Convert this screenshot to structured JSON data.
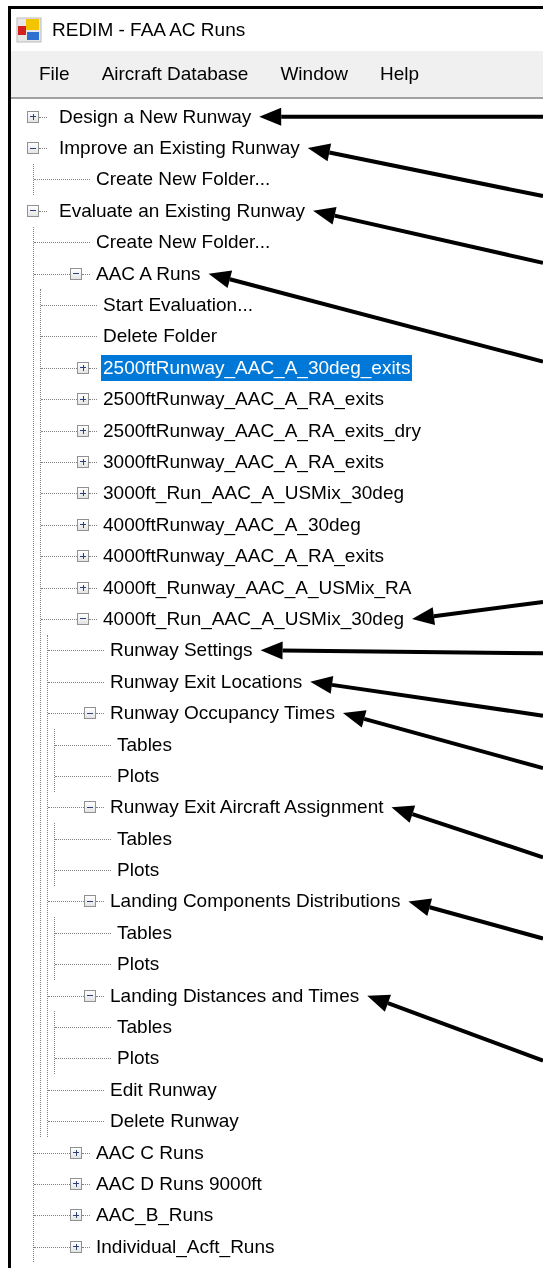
{
  "window": {
    "title": "REDIM - FAA AC Runs"
  },
  "menu": [
    {
      "label": "File"
    },
    {
      "label": "Aircraft Database"
    },
    {
      "label": "Window"
    },
    {
      "label": "Help"
    }
  ],
  "tree": [
    {
      "label": "Design a New Runway",
      "expanded": false,
      "selected": false,
      "arrow": true
    },
    {
      "label": "Improve an Existing Runway",
      "expanded": true,
      "selected": false,
      "arrow": true,
      "children": [
        {
          "label": "Create New Folder...",
          "selected": false,
          "arrow": false
        }
      ]
    },
    {
      "label": "Evaluate an Existing Runway",
      "expanded": true,
      "selected": false,
      "arrow": true,
      "children": [
        {
          "label": "Create New Folder...",
          "selected": false,
          "arrow": false
        },
        {
          "label": "AAC A Runs",
          "expanded": true,
          "selected": false,
          "arrow": true,
          "children": [
            {
              "label": "Start Evaluation...",
              "selected": false,
              "arrow": false
            },
            {
              "label": "Delete Folder",
              "selected": false,
              "arrow": false
            },
            {
              "label": "2500ftRunway_AAC_A_30deg_exits",
              "expanded": false,
              "selected": true,
              "arrow": false
            },
            {
              "label": "2500ftRunway_AAC_A_RA_exits",
              "expanded": false,
              "selected": false,
              "arrow": false
            },
            {
              "label": "2500ftRunway_AAC_A_RA_exits_dry",
              "expanded": false,
              "selected": false,
              "arrow": false
            },
            {
              "label": "3000ftRunway_AAC_A_RA_exits",
              "expanded": false,
              "selected": false,
              "arrow": false
            },
            {
              "label": "3000ft_Run_AAC_A_USMix_30deg",
              "expanded": false,
              "selected": false,
              "arrow": false
            },
            {
              "label": "4000ftRunway_AAC_A_30deg",
              "expanded": false,
              "selected": false,
              "arrow": false
            },
            {
              "label": "4000ftRunway_AAC_A_RA_exits",
              "expanded": false,
              "selected": false,
              "arrow": false
            },
            {
              "label": "4000ft_Runway_AAC_A_USMix_RA",
              "expanded": false,
              "selected": false,
              "arrow": false
            },
            {
              "label": "4000ft_Run_AAC_A_USMix_30deg",
              "expanded": true,
              "selected": false,
              "arrow": true,
              "children": [
                {
                  "label": "Runway Settings",
                  "selected": false,
                  "arrow": true
                },
                {
                  "label": "Runway Exit Locations",
                  "selected": false,
                  "arrow": true
                },
                {
                  "label": "Runway Occupancy Times",
                  "expanded": true,
                  "selected": false,
                  "arrow": true,
                  "children": [
                    {
                      "label": "Tables",
                      "selected": false,
                      "arrow": false
                    },
                    {
                      "label": "Plots",
                      "selected": false,
                      "arrow": false
                    }
                  ]
                },
                {
                  "label": "Runway Exit Aircraft Assignment",
                  "expanded": true,
                  "selected": false,
                  "arrow": true,
                  "children": [
                    {
                      "label": "Tables",
                      "selected": false,
                      "arrow": false
                    },
                    {
                      "label": "Plots",
                      "selected": false,
                      "arrow": false
                    }
                  ]
                },
                {
                  "label": "Landing Components Distributions",
                  "expanded": true,
                  "selected": false,
                  "arrow": true,
                  "children": [
                    {
                      "label": "Tables",
                      "selected": false,
                      "arrow": false
                    },
                    {
                      "label": "Plots",
                      "selected": false,
                      "arrow": false
                    }
                  ]
                },
                {
                  "label": "Landing Distances and Times",
                  "expanded": true,
                  "selected": false,
                  "arrow": true,
                  "children": [
                    {
                      "label": "Tables",
                      "selected": false,
                      "arrow": false
                    },
                    {
                      "label": "Plots",
                      "selected": false,
                      "arrow": false
                    }
                  ]
                },
                {
                  "label": "Edit Runway",
                  "selected": false,
                  "arrow": false
                },
                {
                  "label": "Delete Runway",
                  "selected": false,
                  "arrow": false
                }
              ]
            }
          ]
        },
        {
          "label": "AAC C Runs",
          "expanded": false,
          "selected": false,
          "arrow": false
        },
        {
          "label": "AAC D Runs 9000ft",
          "expanded": false,
          "selected": false,
          "arrow": false
        },
        {
          "label": "AAC_B_Runs",
          "expanded": false,
          "selected": false,
          "arrow": false
        },
        {
          "label": "Individual_Acft_Runs",
          "expanded": false,
          "selected": false,
          "arrow": false
        }
      ]
    }
  ]
}
